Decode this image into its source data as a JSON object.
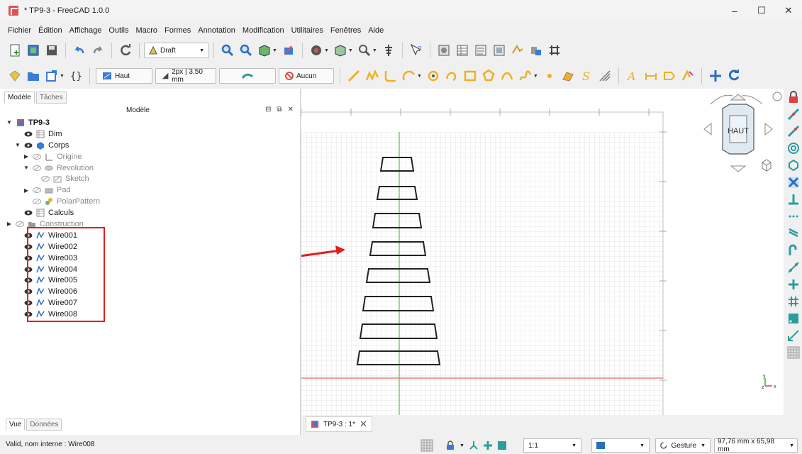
{
  "window": {
    "title": "* TP9-3 - FreeCAD 1.0.0",
    "minimize": "–",
    "maximize": "☐",
    "close": "✕"
  },
  "menu": [
    "Fichier",
    "Édition",
    "Affichage",
    "Outils",
    "Macro",
    "Formes",
    "Annotation",
    "Modification",
    "Utilitaires",
    "Fenêtres",
    "Aide"
  ],
  "toolbar1": {
    "workbench": "Draft"
  },
  "toolbar2": {
    "working_plane": "Haut",
    "line_style": "2px | 3,50 mm",
    "snap": "Aucun"
  },
  "left_panel": {
    "tabs": [
      "Modèle",
      "Tâches"
    ],
    "title": "Modèle",
    "tree": [
      {
        "label": "TP9-3",
        "indent": 0,
        "exp": "▼",
        "bold": true,
        "icon": "document-icon",
        "eye": false
      },
      {
        "label": "Dim",
        "indent": 1,
        "exp": "",
        "icon": "spreadsheet-icon",
        "eye": true
      },
      {
        "label": "Corps",
        "indent": 1,
        "exp": "▼",
        "icon": "body-icon",
        "eye": true
      },
      {
        "label": "Origine",
        "indent": 2,
        "exp": "▶",
        "icon": "origin-icon",
        "eye": "off",
        "dim": true
      },
      {
        "label": "Revolution",
        "indent": 2,
        "exp": "▼",
        "icon": "revolution-icon",
        "eye": "off",
        "dim": true
      },
      {
        "label": "Sketch",
        "indent": 3,
        "exp": "",
        "icon": "sketch-icon",
        "eye": "off",
        "dim": true
      },
      {
        "label": "Pad",
        "indent": 2,
        "exp": "▶",
        "icon": "pad-icon",
        "eye": "off",
        "dim": true
      },
      {
        "label": "PolarPattern",
        "indent": 2,
        "exp": "",
        "icon": "polar-pattern-icon",
        "eye": "off",
        "dim": true
      },
      {
        "label": "Calculs",
        "indent": 1,
        "exp": "",
        "icon": "spreadsheet-icon",
        "eye": true
      },
      {
        "label": "Construction",
        "indent": 0,
        "exp": "▶",
        "icon": "folder-icon",
        "eye": "off",
        "dim": true
      },
      {
        "label": "Wire001",
        "indent": 1,
        "exp": "",
        "icon": "wire-icon",
        "eye": true
      },
      {
        "label": "Wire002",
        "indent": 1,
        "exp": "",
        "icon": "wire-icon",
        "eye": true
      },
      {
        "label": "Wire003",
        "indent": 1,
        "exp": "",
        "icon": "wire-icon",
        "eye": true
      },
      {
        "label": "Wire004",
        "indent": 1,
        "exp": "",
        "icon": "wire-icon",
        "eye": true
      },
      {
        "label": "Wire005",
        "indent": 1,
        "exp": "",
        "icon": "wire-icon",
        "eye": true
      },
      {
        "label": "Wire006",
        "indent": 1,
        "exp": "",
        "icon": "wire-icon",
        "eye": true
      },
      {
        "label": "Wire007",
        "indent": 1,
        "exp": "",
        "icon": "wire-icon",
        "eye": true
      },
      {
        "label": "Wire008",
        "indent": 1,
        "exp": "",
        "icon": "wire-icon",
        "eye": true
      }
    ],
    "bottom_tabs": [
      "Vue",
      "Données"
    ]
  },
  "view": {
    "navcube_label": "HAUT",
    "doc_tab": "TP9-3 : 1*"
  },
  "status": {
    "message": "Valid, nom interne : Wire008",
    "zoom": "1:1",
    "nav_style": "Gesture",
    "dimensions": "97,76 mm x 65,98 mm"
  },
  "colors": {
    "highlight": "#e02020",
    "axis_x": "#e04040",
    "axis_y": "#30b030",
    "grid": "#c8c8c8"
  }
}
